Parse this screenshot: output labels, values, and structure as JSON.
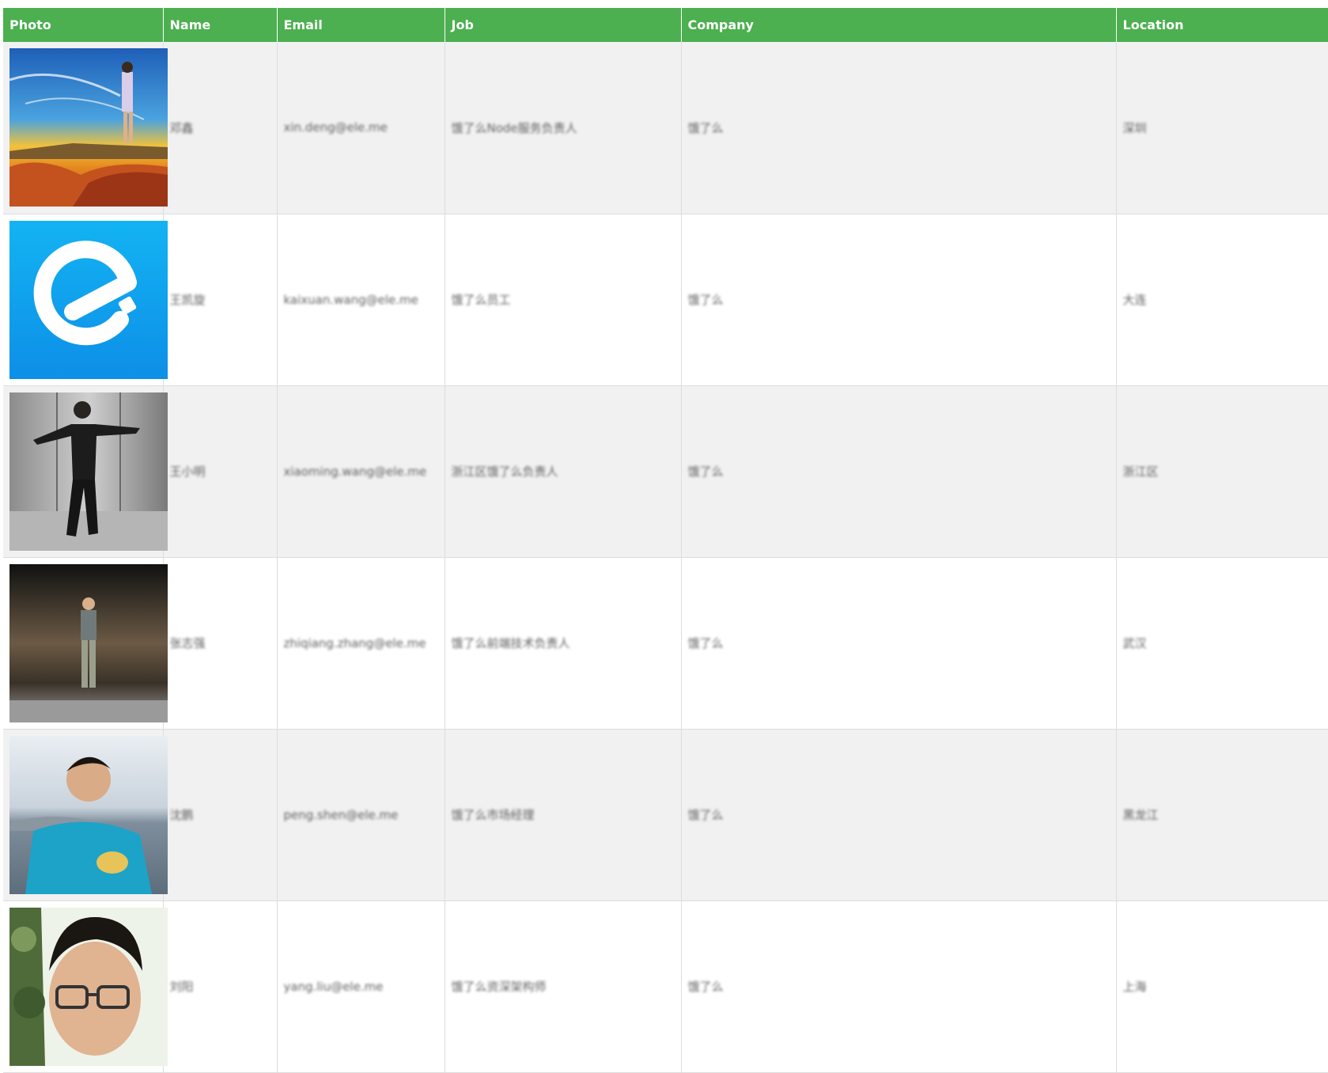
{
  "table": {
    "headers": [
      "Photo",
      "Name",
      "Email",
      "Job",
      "Company",
      "Location"
    ],
    "rows": [
      {
        "photo": "sunset-coast-rocks-photo",
        "name": "邓鑫",
        "email": "xin.deng@ele.me",
        "job": "饿了么Node服务负责人",
        "company": "饿了么",
        "location": "深圳"
      },
      {
        "photo": "eleme-logo",
        "name": "王凯旋",
        "email": "kaixuan.wang@ele.me",
        "job": "饿了么员工",
        "company": "饿了么",
        "location": "大连"
      },
      {
        "photo": "man-in-elevator-photo",
        "name": "王小明",
        "email": "xiaoming.wang@ele.me",
        "job": "浙江区饿了么负责人",
        "company": "饿了么",
        "location": "浙江区"
      },
      {
        "photo": "man-standing-hallway-photo",
        "name": "张志强",
        "email": "zhiqiang.zhang@ele.me",
        "job": "饿了么前端技术负责人",
        "company": "饿了么",
        "location": "武汉"
      },
      {
        "photo": "young-man-lakeside-photo",
        "name": "沈鹏",
        "email": "peng.shen@ele.me",
        "job": "饿了么市场经理",
        "company": "饿了么",
        "location": "黑龙江"
      },
      {
        "photo": "man-with-glasses-selfie-photo",
        "name": "刘阳",
        "email": "yang.liu@ele.me",
        "job": "饿了么资深架构师",
        "company": "饿了么",
        "location": "上海"
      }
    ]
  },
  "colors": {
    "header_bg": "#4caf50",
    "header_text": "#ffffff",
    "row_odd": "#f1f1f1",
    "row_even": "#ffffff",
    "border": "#dddddd",
    "eleme_blue": "#0a9dee"
  }
}
